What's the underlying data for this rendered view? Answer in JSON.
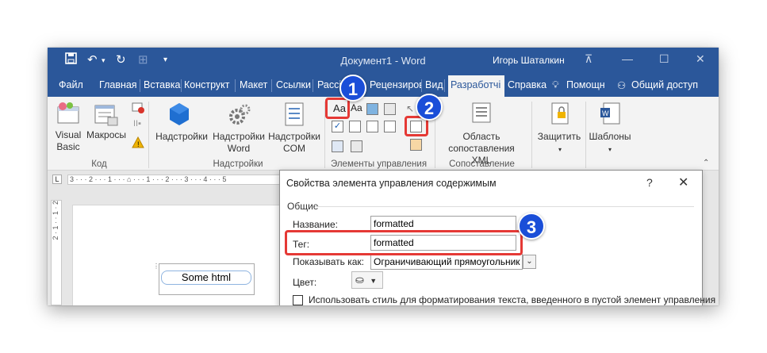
{
  "window": {
    "title": "Документ1 - Word",
    "user": "Игорь Шаталкин"
  },
  "tabs": [
    "Файл",
    "Главная",
    "Вставка",
    "Конструкт",
    "Макет",
    "Ссылки",
    "Рассі",
    "Рецензиров",
    "Вид"
  ],
  "active_tab": "Разработчі",
  "tabs_right": {
    "help": "Справка",
    "tell_me": "Помощн",
    "share": "Общий доступ"
  },
  "ribbon": {
    "visual_basic": "Visual Basic",
    "macros": "Макросы",
    "group_code": "Код",
    "addins": "Надстройки",
    "word_addins": "Надстройки Word",
    "com_addins": "Надстройки COM",
    "group_addins": "Надстройки",
    "text_control_glyph": "Aa",
    "text_control_glyph2": "Aa",
    "group_controls": "Элементы управления",
    "xml_mapping": "Область сопоставления XML",
    "group_mapping": "Сопоставление",
    "protect": "Защитить",
    "templates": "Шаблоны"
  },
  "ruler": {
    "horizontal": "3 · · · 2 · · · 1 · · · ⌂ · · · 1 · · · 2 · · · 3 · · · 4 · · · 5",
    "vertical": "2 · 1 · · 1 · 2"
  },
  "document": {
    "control_text": "Some html"
  },
  "dialog": {
    "title": "Свойства элемента управления содержимым",
    "help": "?",
    "close": "✕",
    "section": "Общие",
    "name_label": "Название:",
    "name_value": "formatted",
    "tag_label": "Тег:",
    "tag_value": "formatted",
    "show_as_label": "Показывать как:",
    "show_as_value": "Ограничивающий прямоугольник",
    "color_label": "Цвет:",
    "style_checkbox_label": "Использовать стиль для форматирования текста, введенного в пустой элемент управления"
  },
  "badges": [
    "1",
    "2",
    "3"
  ],
  "colors": {
    "title_blue": "#2b579a",
    "highlight_red": "#e53935",
    "badge_blue": "#1a4ed8"
  },
  "icons": [
    "save-icon",
    "undo-icon",
    "redo-icon",
    "table-icon",
    "customize-icon",
    "ribbon-display-icon",
    "minimize-icon",
    "maximize-icon",
    "close-icon",
    "lightbulb-icon",
    "person-icon"
  ]
}
